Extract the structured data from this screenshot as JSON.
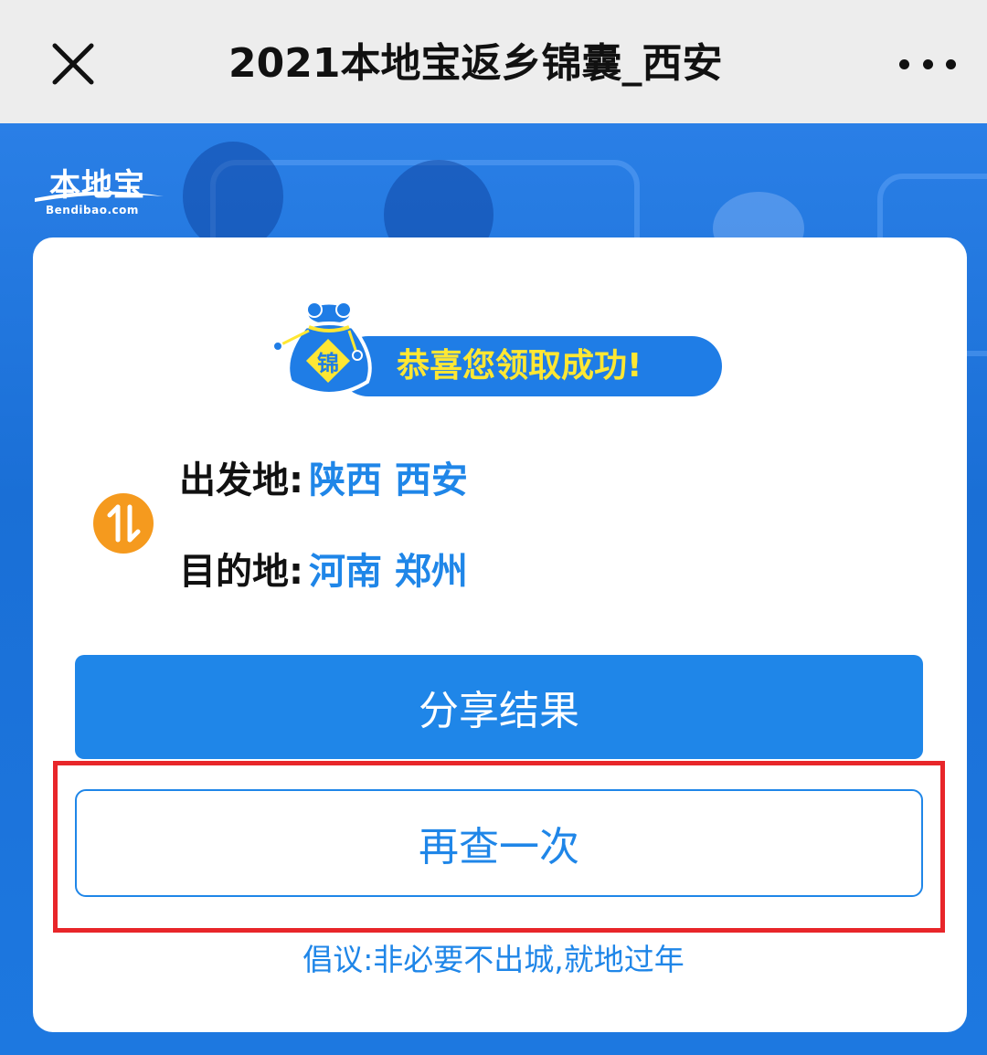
{
  "titlebar": {
    "title": "2021本地宝返乡锦囊_西安",
    "close_icon": "close-icon",
    "more_icon": "more-icon"
  },
  "logo": {
    "name": "本地宝",
    "domain": "Bendibao.com"
  },
  "banner": {
    "bag_char": "锦",
    "text": "恭喜您领取成功!"
  },
  "route": {
    "origin_label": "出发地:",
    "origin_value": "陕西 西安",
    "destination_label": "目的地:",
    "destination_value": "河南 郑州",
    "swap_icon": "swap-arrows-icon"
  },
  "actions": {
    "share_label": "分享结果",
    "again_label": "再查一次"
  },
  "advice": "倡议:非必要不出城,就地过年",
  "colors": {
    "primary": "#1f86e8",
    "banner_text": "#ffe733",
    "swap_icon_bg": "#f59a1e",
    "highlight": "#e8262a",
    "background": "#1e72d8"
  }
}
